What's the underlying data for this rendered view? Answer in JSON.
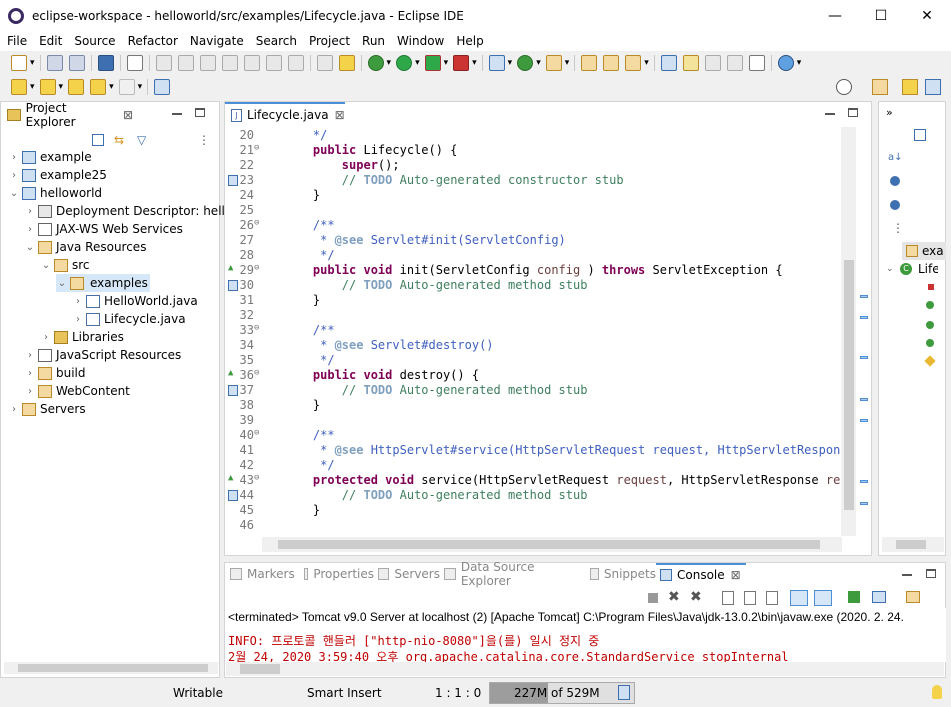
{
  "window": {
    "title": "eclipse-workspace - helloworld/src/examples/Lifecycle.java - Eclipse IDE",
    "minimize": "—",
    "maximize": "☐",
    "close": "✕"
  },
  "menu": [
    "File",
    "Edit",
    "Source",
    "Refactor",
    "Navigate",
    "Search",
    "Project",
    "Run",
    "Window",
    "Help"
  ],
  "explorer": {
    "tab_label": "Project Explorer",
    "close_glyph": "⊠",
    "items": [
      {
        "label": "example",
        "indent": 0,
        "arrow": "›",
        "icon": "project"
      },
      {
        "label": "example25",
        "indent": 0,
        "arrow": "›",
        "icon": "project"
      },
      {
        "label": "helloworld",
        "indent": 0,
        "arrow": "⌄",
        "icon": "project"
      },
      {
        "label": "Deployment Descriptor: hellc",
        "indent": 1,
        "arrow": "›",
        "icon": "descriptor"
      },
      {
        "label": "JAX-WS Web Services",
        "indent": 1,
        "arrow": "›",
        "icon": "ws"
      },
      {
        "label": "Java Resources",
        "indent": 1,
        "arrow": "⌄",
        "icon": "javares"
      },
      {
        "label": "src",
        "indent": 2,
        "arrow": "⌄",
        "icon": "srcfolder"
      },
      {
        "label": "examples",
        "indent": 3,
        "arrow": "⌄",
        "icon": "package",
        "selected": true
      },
      {
        "label": "HelloWorld.java",
        "indent": 4,
        "arrow": "›",
        "icon": "javafile"
      },
      {
        "label": "Lifecycle.java",
        "indent": 4,
        "arrow": "›",
        "icon": "javafile"
      },
      {
        "label": "Libraries",
        "indent": 2,
        "arrow": "›",
        "icon": "lib"
      },
      {
        "label": "JavaScript Resources",
        "indent": 1,
        "arrow": "›",
        "icon": "js"
      },
      {
        "label": "build",
        "indent": 1,
        "arrow": "›",
        "icon": "folder"
      },
      {
        "label": "WebContent",
        "indent": 1,
        "arrow": "›",
        "icon": "folder"
      },
      {
        "label": "Servers",
        "indent": 0,
        "arrow": "›",
        "icon": "folder"
      }
    ]
  },
  "editor": {
    "tab_label": "Lifecycle.java",
    "close_glyph": "⊠",
    "lines": [
      {
        "n": "20",
        "parts": [
          [
            "",
            "    "
          ],
          [
            "jd",
            "*/"
          ]
        ]
      },
      {
        "n": "21",
        "fold": "⊖",
        "parts": [
          [
            "kw",
            "    public "
          ],
          [
            "",
            "Lifecycle() {"
          ]
        ]
      },
      {
        "n": "22",
        "parts": [
          [
            "kw",
            "        super"
          ],
          [
            "",
            "();"
          ]
        ]
      },
      {
        "n": "23",
        "gm": "task",
        "parts": [
          [
            "cm",
            "        // "
          ],
          [
            "todo",
            "TODO"
          ],
          [
            "cm",
            " Auto-generated constructor stub"
          ]
        ]
      },
      {
        "n": "24",
        "parts": [
          [
            "",
            "    }"
          ]
        ]
      },
      {
        "n": "25",
        "parts": [
          [
            "",
            ""
          ]
        ]
      },
      {
        "n": "26",
        "fold": "⊖",
        "parts": [
          [
            "jd",
            "    /**"
          ]
        ]
      },
      {
        "n": "27",
        "parts": [
          [
            "jd",
            "     * "
          ],
          [
            "tag",
            "@see"
          ],
          [
            "jd",
            " Servlet#init(ServletConfig)"
          ]
        ]
      },
      {
        "n": "28",
        "parts": [
          [
            "jd",
            "     */"
          ]
        ]
      },
      {
        "n": "29",
        "fold": "⊖",
        "gm": "override",
        "parts": [
          [
            "kw",
            "    public void "
          ],
          [
            "",
            "init(ServletConfig "
          ],
          [
            "param",
            "config"
          ],
          [
            "",
            " ) "
          ],
          [
            "kw",
            "throws "
          ],
          [
            "",
            "ServletException {"
          ]
        ]
      },
      {
        "n": "30",
        "gm": "task",
        "parts": [
          [
            "cm",
            "        // "
          ],
          [
            "todo",
            "TODO"
          ],
          [
            "cm",
            " Auto-generated method stub"
          ]
        ]
      },
      {
        "n": "31",
        "parts": [
          [
            "",
            "    }"
          ]
        ]
      },
      {
        "n": "32",
        "parts": [
          [
            "",
            ""
          ]
        ]
      },
      {
        "n": "33",
        "fold": "⊖",
        "parts": [
          [
            "jd",
            "    /**"
          ]
        ]
      },
      {
        "n": "34",
        "parts": [
          [
            "jd",
            "     * "
          ],
          [
            "tag",
            "@see"
          ],
          [
            "jd",
            " Servlet#destroy()"
          ]
        ]
      },
      {
        "n": "35",
        "parts": [
          [
            "jd",
            "     */"
          ]
        ]
      },
      {
        "n": "36",
        "fold": "⊖",
        "gm": "override",
        "parts": [
          [
            "kw",
            "    public void "
          ],
          [
            "",
            "destroy() {"
          ]
        ]
      },
      {
        "n": "37",
        "gm": "task",
        "parts": [
          [
            "cm",
            "        // "
          ],
          [
            "todo",
            "TODO"
          ],
          [
            "cm",
            " Auto-generated method stub"
          ]
        ]
      },
      {
        "n": "38",
        "parts": [
          [
            "",
            "    }"
          ]
        ]
      },
      {
        "n": "39",
        "parts": [
          [
            "",
            ""
          ]
        ]
      },
      {
        "n": "40",
        "fold": "⊖",
        "parts": [
          [
            "jd",
            "    /**"
          ]
        ]
      },
      {
        "n": "41",
        "parts": [
          [
            "jd",
            "     * "
          ],
          [
            "tag",
            "@see"
          ],
          [
            "jd",
            " HttpServlet#service(HttpServletRequest request, HttpServletResponse resp"
          ]
        ]
      },
      {
        "n": "42",
        "parts": [
          [
            "jd",
            "     */"
          ]
        ]
      },
      {
        "n": "43",
        "fold": "⊖",
        "gm": "override",
        "parts": [
          [
            "kw",
            "    protected void "
          ],
          [
            "",
            "service(HttpServletRequest "
          ],
          [
            "param",
            "request"
          ],
          [
            ",",
            ", HttpServletResponse "
          ],
          [
            "param",
            "response"
          ]
        ]
      },
      {
        "n": "44",
        "gm": "task",
        "parts": [
          [
            "cm",
            "        // "
          ],
          [
            "todo",
            "TODO"
          ],
          [
            "cm",
            " Auto-generated method stub"
          ]
        ]
      },
      {
        "n": "45",
        "parts": [
          [
            "",
            "    }"
          ]
        ]
      },
      {
        "n": "46",
        "parts": [
          [
            "",
            ""
          ]
        ]
      }
    ]
  },
  "bottom_tabs": [
    {
      "label": "Markers"
    },
    {
      "label": "Properties"
    },
    {
      "label": "Servers"
    },
    {
      "label": "Data Source Explorer"
    },
    {
      "label": "Snippets"
    },
    {
      "label": "Console",
      "active": true
    }
  ],
  "console": {
    "header": "<terminated> Tomcat v9.0 Server at localhost (2) [Apache Tomcat] C:\\Program Files\\Java\\jdk-13.0.2\\bin\\javaw.exe (2020. 2. 24.",
    "lines": [
      "INFO: 프로토콜 핸들러 [\"http-nio-8080\"]을(를) 일시 정지 중",
      "2월 24, 2020 3:59:40 오후 org.apache.catalina.core.StandardService stopInternal"
    ]
  },
  "outline": {
    "items": [
      "exa",
      "Lifecycle"
    ]
  },
  "status": {
    "writable": "Writable",
    "insert": "Smart Insert",
    "position": "1 : 1 : 0",
    "heap_used": "227M",
    "heap_of": "of 529M"
  },
  "colors": {
    "accent": "#3f7f5f",
    "keyword": "#7f0055",
    "javadoc": "#3f5fbf",
    "console_red": "#c00000"
  }
}
